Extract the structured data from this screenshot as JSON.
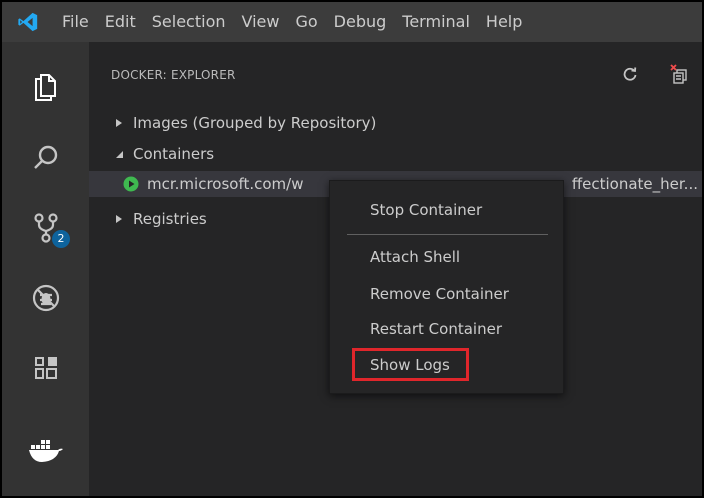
{
  "menubar": {
    "logo": "vscode-logo-icon",
    "items": [
      "File",
      "Edit",
      "Selection",
      "View",
      "Go",
      "Debug",
      "Terminal",
      "Help"
    ]
  },
  "activitybar": {
    "icons": [
      "explorer-icon",
      "search-icon",
      "source-control-icon",
      "debug-icon",
      "extensions-icon",
      "docker-icon"
    ],
    "source_control_badge": "2"
  },
  "sidebar": {
    "title": "DOCKER: EXPLORER",
    "actions": [
      "refresh-icon",
      "prune-system-icon"
    ],
    "tree": {
      "images": "Images (Grouped by Repository)",
      "containers": "Containers",
      "container_item": {
        "image": "mcr.microsoft.com/w",
        "name_suffix": "ffectionate_her...",
        "status_color": "#3fb950"
      },
      "registries": "Registries"
    }
  },
  "context_menu": {
    "items": [
      "Stop Container",
      "Attach Shell",
      "Remove Container",
      "Restart Container",
      "Show Logs"
    ],
    "highlighted": "Show Logs",
    "highlight_color": "#e0262b"
  },
  "colors": {
    "menubar_bg": "#3c3c3c",
    "activitybar_bg": "#333333",
    "sidebar_bg": "#252526",
    "badge_bg": "#0e639c"
  }
}
